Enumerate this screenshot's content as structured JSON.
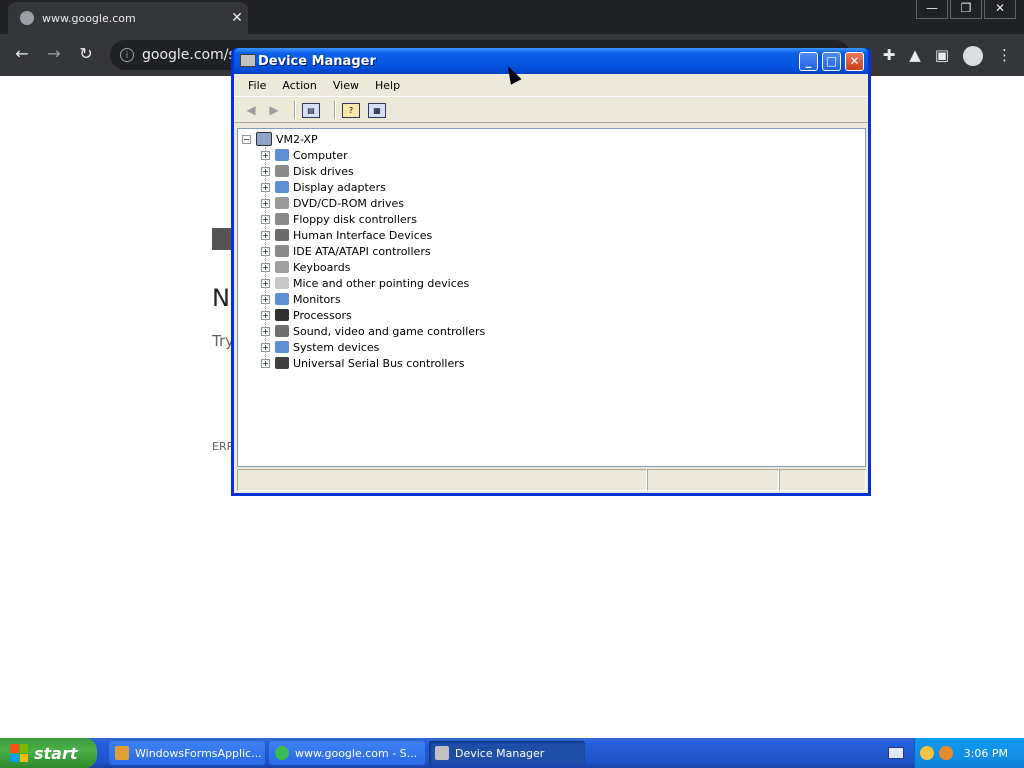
{
  "browser": {
    "tab_title": "www.google.com",
    "address": "google.com/se",
    "page": {
      "heading": "N",
      "hint": "Try",
      "error_code": "ERR"
    }
  },
  "window": {
    "title": "Device Manager",
    "menu": [
      "File",
      "Action",
      "View",
      "Help"
    ],
    "toolbar_icons": [
      "back-icon",
      "forward-icon",
      "show-hide-console-tree-icon",
      "properties-icon",
      "help-icon"
    ],
    "tree": {
      "root": "VM2-XP",
      "items": [
        {
          "label": "Computer",
          "icon": "computer-icon",
          "color": "#5b8fd6"
        },
        {
          "label": "Disk drives",
          "icon": "disk-drive-icon",
          "color": "#8a8a8a"
        },
        {
          "label": "Display adapters",
          "icon": "display-adapter-icon",
          "color": "#5b8fd6"
        },
        {
          "label": "DVD/CD-ROM drives",
          "icon": "dvd-drive-icon",
          "color": "#9a9a9a"
        },
        {
          "label": "Floppy disk controllers",
          "icon": "floppy-controller-icon",
          "color": "#8a8a8a"
        },
        {
          "label": "Human Interface Devices",
          "icon": "hid-icon",
          "color": "#6c6c6c"
        },
        {
          "label": "IDE ATA/ATAPI controllers",
          "icon": "ide-controller-icon",
          "color": "#8a8a8a"
        },
        {
          "label": "Keyboards",
          "icon": "keyboard-icon",
          "color": "#a0a0a0"
        },
        {
          "label": "Mice and other pointing devices",
          "icon": "mouse-icon",
          "color": "#c8c8c8"
        },
        {
          "label": "Monitors",
          "icon": "monitor-icon",
          "color": "#5b8fd6"
        },
        {
          "label": "Processors",
          "icon": "processor-icon",
          "color": "#303030"
        },
        {
          "label": "Sound, video and game controllers",
          "icon": "sound-icon",
          "color": "#707070"
        },
        {
          "label": "System devices",
          "icon": "system-device-icon",
          "color": "#5b8fd6"
        },
        {
          "label": "Universal Serial Bus controllers",
          "icon": "usb-icon",
          "color": "#404040"
        }
      ]
    }
  },
  "taskbar": {
    "start_label": "start",
    "tasks": [
      {
        "label": "WindowsFormsApplic...",
        "icon": "forms-app-icon",
        "color": "#e0a030"
      },
      {
        "label": "www.google.com - S...",
        "icon": "browser-icon",
        "color": "#3cba54"
      },
      {
        "label": "Device Manager",
        "icon": "device-manager-icon",
        "color": "#c0c0c0"
      }
    ],
    "clock": "3:06 PM"
  }
}
